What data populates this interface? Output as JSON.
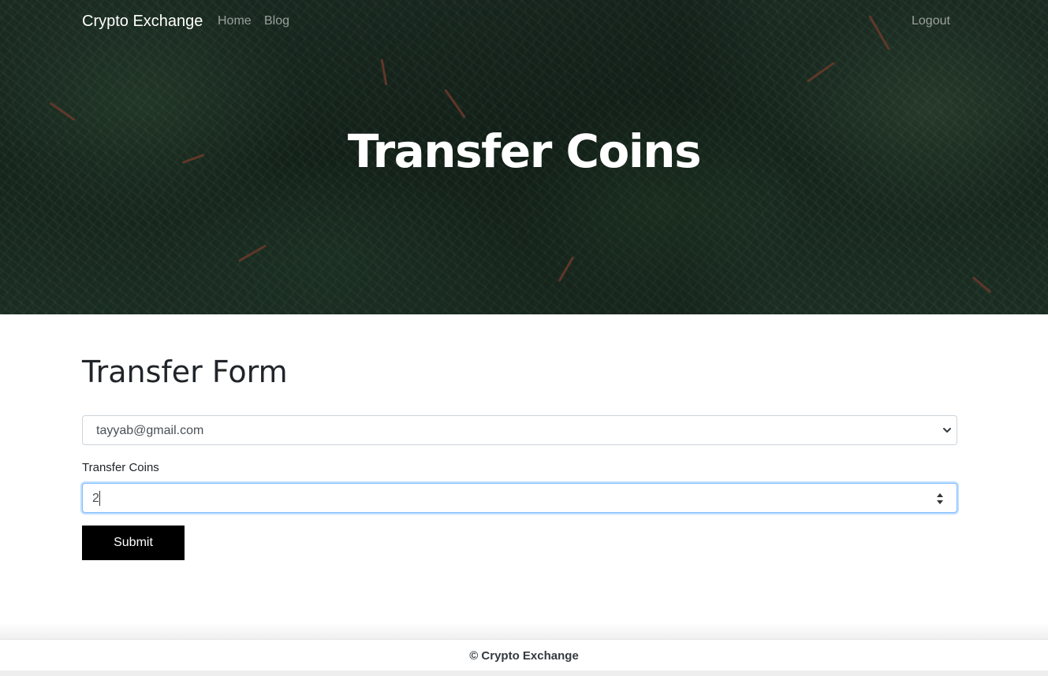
{
  "navbar": {
    "brand": "Crypto Exchange",
    "links": {
      "home": "Home",
      "blog": "Blog",
      "logout": "Logout"
    }
  },
  "hero": {
    "title": "Transfer Coins"
  },
  "form": {
    "title": "Transfer Form",
    "recipient": {
      "selected": "tayyab@gmail.com"
    },
    "amount": {
      "label": "Transfer Coins",
      "value": "2"
    },
    "submit_label": "Submit"
  },
  "footer": {
    "text": "© Crypto Exchange"
  },
  "colors": {
    "hero_overlay": "#14231b",
    "button": "#000000",
    "focus_ring": "#80bdff"
  },
  "icons": [
    "chevron-down-icon",
    "spinner-arrows-icon"
  ]
}
